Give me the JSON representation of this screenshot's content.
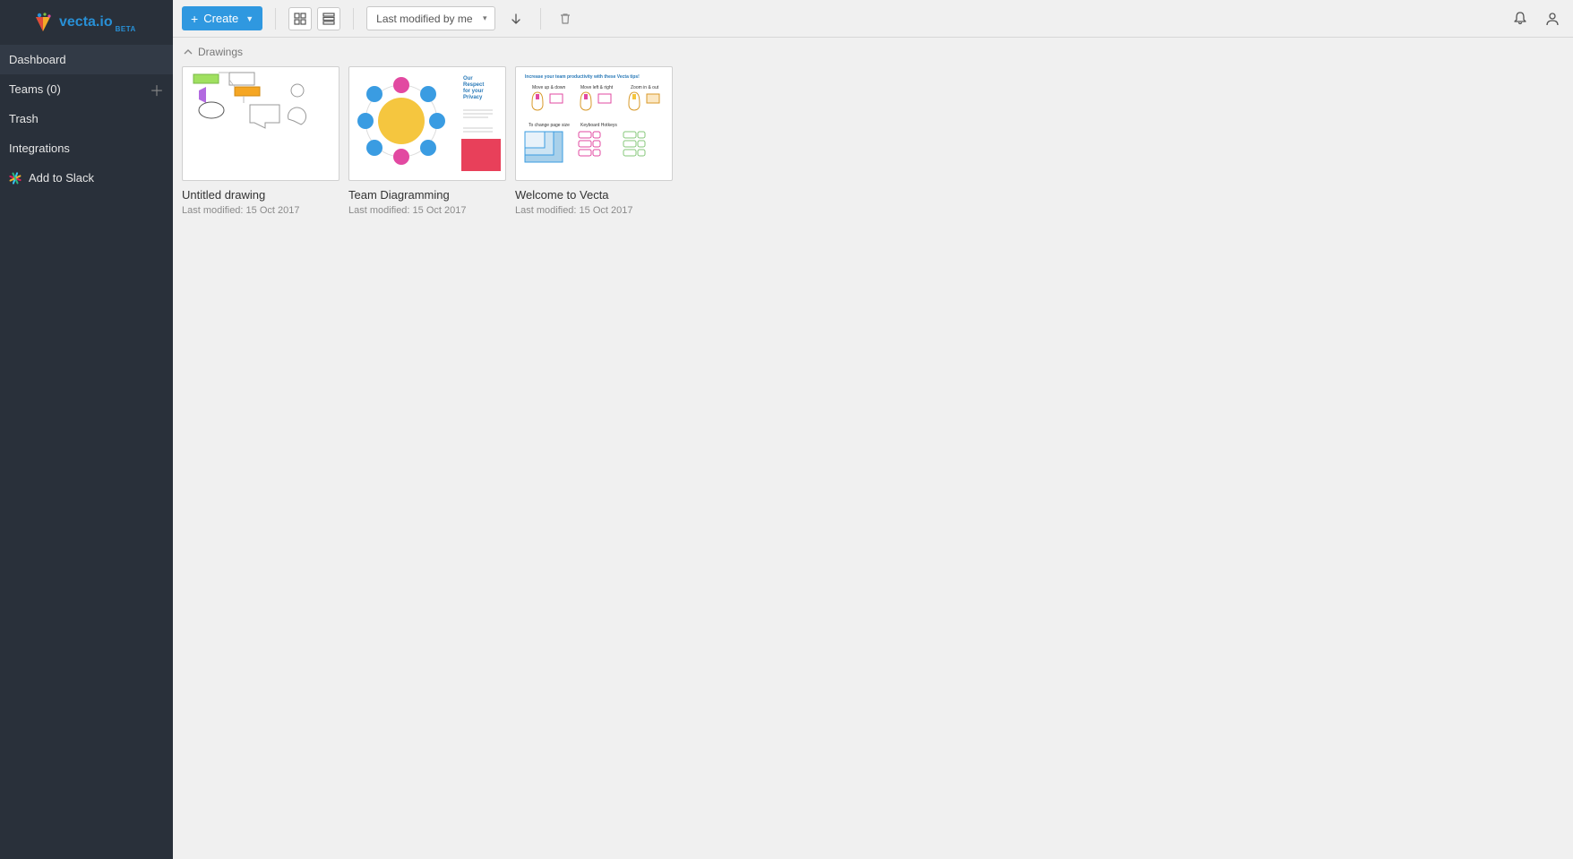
{
  "brand": {
    "name": "vecta.io",
    "tag": "BETA"
  },
  "sidebar": {
    "items": [
      {
        "label": "Dashboard"
      },
      {
        "label": "Teams (0)"
      },
      {
        "label": "Trash"
      },
      {
        "label": "Integrations"
      },
      {
        "label": "Add to Slack"
      }
    ]
  },
  "toolbar": {
    "create_label": "Create",
    "sort_label": "Last modified by me"
  },
  "section": {
    "title": "Drawings"
  },
  "drawings": [
    {
      "title": "Untitled drawing",
      "modified": "Last modified: 15 Oct 2017"
    },
    {
      "title": "Team Diagramming",
      "modified": "Last modified: 15 Oct 2017"
    },
    {
      "title": "Welcome to Vecta",
      "modified": "Last modified: 15 Oct 2017"
    }
  ]
}
